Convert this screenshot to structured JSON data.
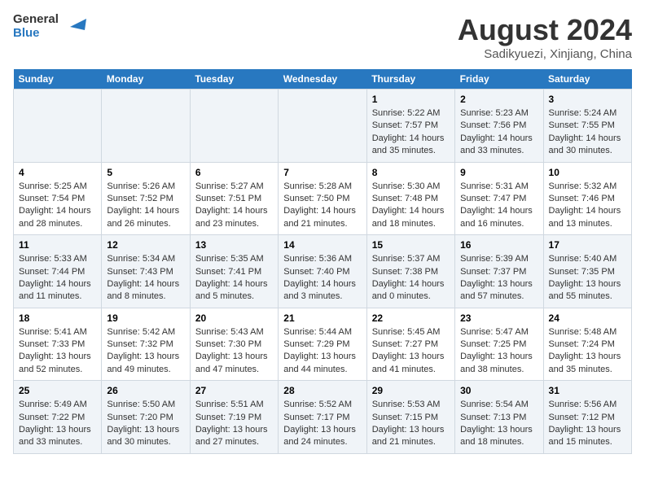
{
  "logo": {
    "line1": "General",
    "line2": "Blue"
  },
  "title": "August 2024",
  "subtitle": "Sadikyuezi, Xinjiang, China",
  "days_of_week": [
    "Sunday",
    "Monday",
    "Tuesday",
    "Wednesday",
    "Thursday",
    "Friday",
    "Saturday"
  ],
  "weeks": [
    [
      {
        "day": "",
        "info": ""
      },
      {
        "day": "",
        "info": ""
      },
      {
        "day": "",
        "info": ""
      },
      {
        "day": "",
        "info": ""
      },
      {
        "day": "1",
        "info": "Sunrise: 5:22 AM\nSunset: 7:57 PM\nDaylight: 14 hours\nand 35 minutes."
      },
      {
        "day": "2",
        "info": "Sunrise: 5:23 AM\nSunset: 7:56 PM\nDaylight: 14 hours\nand 33 minutes."
      },
      {
        "day": "3",
        "info": "Sunrise: 5:24 AM\nSunset: 7:55 PM\nDaylight: 14 hours\nand 30 minutes."
      }
    ],
    [
      {
        "day": "4",
        "info": "Sunrise: 5:25 AM\nSunset: 7:54 PM\nDaylight: 14 hours\nand 28 minutes."
      },
      {
        "day": "5",
        "info": "Sunrise: 5:26 AM\nSunset: 7:52 PM\nDaylight: 14 hours\nand 26 minutes."
      },
      {
        "day": "6",
        "info": "Sunrise: 5:27 AM\nSunset: 7:51 PM\nDaylight: 14 hours\nand 23 minutes."
      },
      {
        "day": "7",
        "info": "Sunrise: 5:28 AM\nSunset: 7:50 PM\nDaylight: 14 hours\nand 21 minutes."
      },
      {
        "day": "8",
        "info": "Sunrise: 5:30 AM\nSunset: 7:48 PM\nDaylight: 14 hours\nand 18 minutes."
      },
      {
        "day": "9",
        "info": "Sunrise: 5:31 AM\nSunset: 7:47 PM\nDaylight: 14 hours\nand 16 minutes."
      },
      {
        "day": "10",
        "info": "Sunrise: 5:32 AM\nSunset: 7:46 PM\nDaylight: 14 hours\nand 13 minutes."
      }
    ],
    [
      {
        "day": "11",
        "info": "Sunrise: 5:33 AM\nSunset: 7:44 PM\nDaylight: 14 hours\nand 11 minutes."
      },
      {
        "day": "12",
        "info": "Sunrise: 5:34 AM\nSunset: 7:43 PM\nDaylight: 14 hours\nand 8 minutes."
      },
      {
        "day": "13",
        "info": "Sunrise: 5:35 AM\nSunset: 7:41 PM\nDaylight: 14 hours\nand 5 minutes."
      },
      {
        "day": "14",
        "info": "Sunrise: 5:36 AM\nSunset: 7:40 PM\nDaylight: 14 hours\nand 3 minutes."
      },
      {
        "day": "15",
        "info": "Sunrise: 5:37 AM\nSunset: 7:38 PM\nDaylight: 14 hours\nand 0 minutes."
      },
      {
        "day": "16",
        "info": "Sunrise: 5:39 AM\nSunset: 7:37 PM\nDaylight: 13 hours\nand 57 minutes."
      },
      {
        "day": "17",
        "info": "Sunrise: 5:40 AM\nSunset: 7:35 PM\nDaylight: 13 hours\nand 55 minutes."
      }
    ],
    [
      {
        "day": "18",
        "info": "Sunrise: 5:41 AM\nSunset: 7:33 PM\nDaylight: 13 hours\nand 52 minutes."
      },
      {
        "day": "19",
        "info": "Sunrise: 5:42 AM\nSunset: 7:32 PM\nDaylight: 13 hours\nand 49 minutes."
      },
      {
        "day": "20",
        "info": "Sunrise: 5:43 AM\nSunset: 7:30 PM\nDaylight: 13 hours\nand 47 minutes."
      },
      {
        "day": "21",
        "info": "Sunrise: 5:44 AM\nSunset: 7:29 PM\nDaylight: 13 hours\nand 44 minutes."
      },
      {
        "day": "22",
        "info": "Sunrise: 5:45 AM\nSunset: 7:27 PM\nDaylight: 13 hours\nand 41 minutes."
      },
      {
        "day": "23",
        "info": "Sunrise: 5:47 AM\nSunset: 7:25 PM\nDaylight: 13 hours\nand 38 minutes."
      },
      {
        "day": "24",
        "info": "Sunrise: 5:48 AM\nSunset: 7:24 PM\nDaylight: 13 hours\nand 35 minutes."
      }
    ],
    [
      {
        "day": "25",
        "info": "Sunrise: 5:49 AM\nSunset: 7:22 PM\nDaylight: 13 hours\nand 33 minutes."
      },
      {
        "day": "26",
        "info": "Sunrise: 5:50 AM\nSunset: 7:20 PM\nDaylight: 13 hours\nand 30 minutes."
      },
      {
        "day": "27",
        "info": "Sunrise: 5:51 AM\nSunset: 7:19 PM\nDaylight: 13 hours\nand 27 minutes."
      },
      {
        "day": "28",
        "info": "Sunrise: 5:52 AM\nSunset: 7:17 PM\nDaylight: 13 hours\nand 24 minutes."
      },
      {
        "day": "29",
        "info": "Sunrise: 5:53 AM\nSunset: 7:15 PM\nDaylight: 13 hours\nand 21 minutes."
      },
      {
        "day": "30",
        "info": "Sunrise: 5:54 AM\nSunset: 7:13 PM\nDaylight: 13 hours\nand 18 minutes."
      },
      {
        "day": "31",
        "info": "Sunrise: 5:56 AM\nSunset: 7:12 PM\nDaylight: 13 hours\nand 15 minutes."
      }
    ]
  ]
}
